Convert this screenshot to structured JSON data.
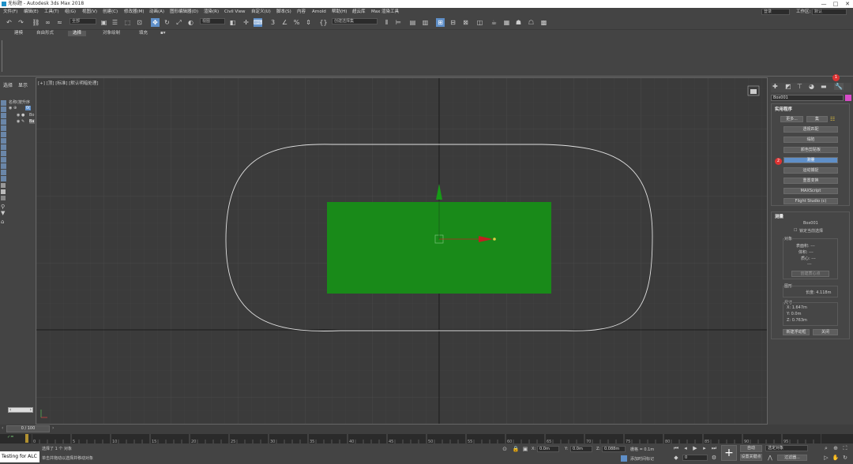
{
  "titlebar": {
    "title": "无标题 - Autodesk 3ds Max 2018",
    "min": "—",
    "max": "□",
    "close": "✕"
  },
  "menu": [
    "文件(F)",
    "编辑(E)",
    "工具(T)",
    "组(G)",
    "视图(V)",
    "创建(C)",
    "修改器(M)",
    "动画(A)",
    "图形编辑器(D)",
    "渲染(R)",
    "Civil View",
    "自定义(U)",
    "脚本(S)",
    "内容",
    "Arnold",
    "帮助(H)",
    "超云库",
    "Max 渲染工具"
  ],
  "menu_right": {
    "user_dropdown": "登录",
    "workspace_label": "工作区:",
    "workspace_value": "默认"
  },
  "toolbar": {
    "filter_dropdown": "全部",
    "view_dropdown": "视图",
    "selection_set": "创建选择集"
  },
  "ribbon_tabs": [
    "建模",
    "自由形式",
    "选择",
    "对象绘制",
    "填充"
  ],
  "ribbon_active": "选择",
  "left_panel": {
    "tab1": "选择",
    "tab2": "显示",
    "tree_header": "名称(按升序",
    "rows": [
      "Bo",
      "Ba"
    ]
  },
  "viewport": {
    "label": "[+] [顶] [标准] [默认明暗处理]"
  },
  "command_panel": {
    "object_name": "Box001",
    "utilities_header": "实用程序",
    "more_button": "更多...",
    "sets_button": "集",
    "buttons": [
      "透视匹配",
      "塌陷",
      "颜色剪贴板",
      "测量",
      "运动捕捉",
      "重置变换",
      "MAXScript",
      "Flight Studio (c)"
    ],
    "selected_button": "测量",
    "measure_header": "测量",
    "measure_name": "Box001",
    "lock_selection": "锁定当前选择",
    "objects_label": "对象",
    "surface_area": "表面积: ---",
    "volume": "体积: ---",
    "center_mass": "质心: ---",
    "center_mass_value": "---",
    "create_center": "创建质心点",
    "shapes_label": "图形",
    "length": "长度: 4.118m",
    "dimensions_label": "尺寸",
    "dim_x": "X:  1.647m",
    "dim_y": "Y:  0.0m",
    "dim_z": "Z:  0.763m",
    "new_float": "新建浮动框",
    "close_btn": "关闭",
    "badge1": "1",
    "badge2": "2"
  },
  "timeline": {
    "frame": "0 / 100"
  },
  "ruler_ticks": [
    "0",
    "5",
    "10",
    "15",
    "20",
    "25",
    "30",
    "35",
    "40",
    "45",
    "50",
    "55",
    "60",
    "65",
    "70",
    "75",
    "80",
    "85",
    "90",
    "95",
    "100"
  ],
  "status": {
    "script_box": "Testing for ALC",
    "line1": "选择了 1 个 对象",
    "line2": "单击并拖动以选择并移动对象",
    "x": "0.0m",
    "y": "0.0m",
    "z": "0.088m",
    "grid": "栅格 = 0.1m",
    "add_time_tag": "添加时间标记",
    "auto": "自动",
    "set_key": "设置关键点",
    "selected_obj": "选定对象",
    "key_filter": "过滤器...",
    "frame_field": "0"
  },
  "colors": {
    "box": "#198a19",
    "selected": "#5f8fc8",
    "badge": "#dd3333"
  }
}
